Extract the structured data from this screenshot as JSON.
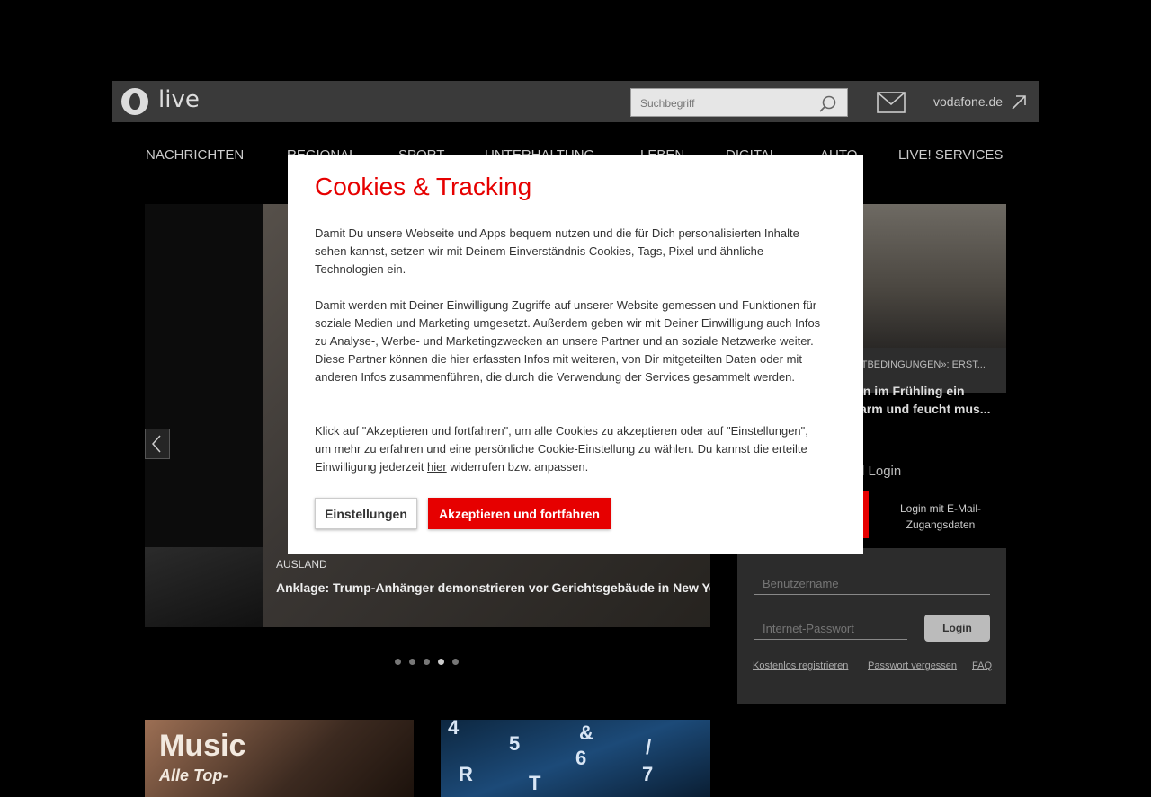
{
  "header": {
    "logo_text": "live",
    "search_placeholder": "Suchbegriff",
    "vodafone_link": "vodafone.de"
  },
  "nav": {
    "items": [
      "NACHRICHTEN",
      "REGIONAL",
      "SPORT",
      "UNTERHALTUNG",
      "LEBEN",
      "DIGITAL",
      "AUTO",
      "LIVE! SERVICES"
    ]
  },
  "hero": {
    "category": "AUSLAND",
    "title": "Anklage: Trump-Anhänger demonstrieren vor Gerichtsgebäude in New Yo",
    "dots_count": 5,
    "active_dot": 3
  },
  "side_article": {
    "category": "RTBEDINGUNGEN»: ERST...",
    "title_line1": "en im Frühling ein",
    "title_line2": "arm und feucht mus..."
  },
  "login": {
    "title": "d Login",
    "email_login": "Login mit E-Mail-Zugangsdaten",
    "username_placeholder": "Benutzername",
    "password_placeholder": "Internet-Passwort",
    "login_button": "Login",
    "register_link": "Kostenlos registrieren",
    "forgot_link": "Passwort vergessen",
    "faq_link": "FAQ"
  },
  "tiles": {
    "music_title": "Music",
    "music_subtitle": "Alle Top-",
    "keys": [
      "4",
      "5",
      "&",
      "6",
      "7",
      "/",
      "R",
      "T"
    ]
  },
  "cookie_modal": {
    "title": "Cookies & Tracking",
    "para1": "Damit Du unsere Webseite und Apps bequem nutzen und die für Dich personalisierten Inhalte sehen kannst, setzen wir mit Deinem Einverständnis Cookies, Tags, Pixel und ähnliche Technologien ein.",
    "para2": "Damit werden mit Deiner Einwilligung Zugriffe auf unserer Website gemessen und Funktionen für soziale Medien und Marketing umgesetzt. Außerdem geben wir mit Deiner Einwilligung auch Infos zu Analyse-, Werbe- und Marketingzwecken an unsere Partner und an soziale Netzwerke weiter. Diese Partner können die hier erfassten Infos mit weiteren, von Dir mitgeteilten Daten oder mit anderen Infos zusammenführen, die durch die Verwendung der Services gesammelt werden.",
    "para3_a": "Klick auf \"Akzeptieren und fortfahren\", um alle Cookies zu akzeptieren oder auf \"Einstellungen\", um mehr zu erfahren und eine persönliche Cookie-Einstellung zu wählen. Du kannst die erteilte Einwilligung jederzeit ",
    "para3_link": "hier",
    "para3_b": " widerrufen bzw. anpassen.",
    "settings_button": "Einstellungen",
    "accept_button": "Akzeptieren und fortfahren"
  },
  "colors": {
    "brand_red": "#e60000",
    "topbar": "#3a3a3a",
    "background": "#000000"
  }
}
